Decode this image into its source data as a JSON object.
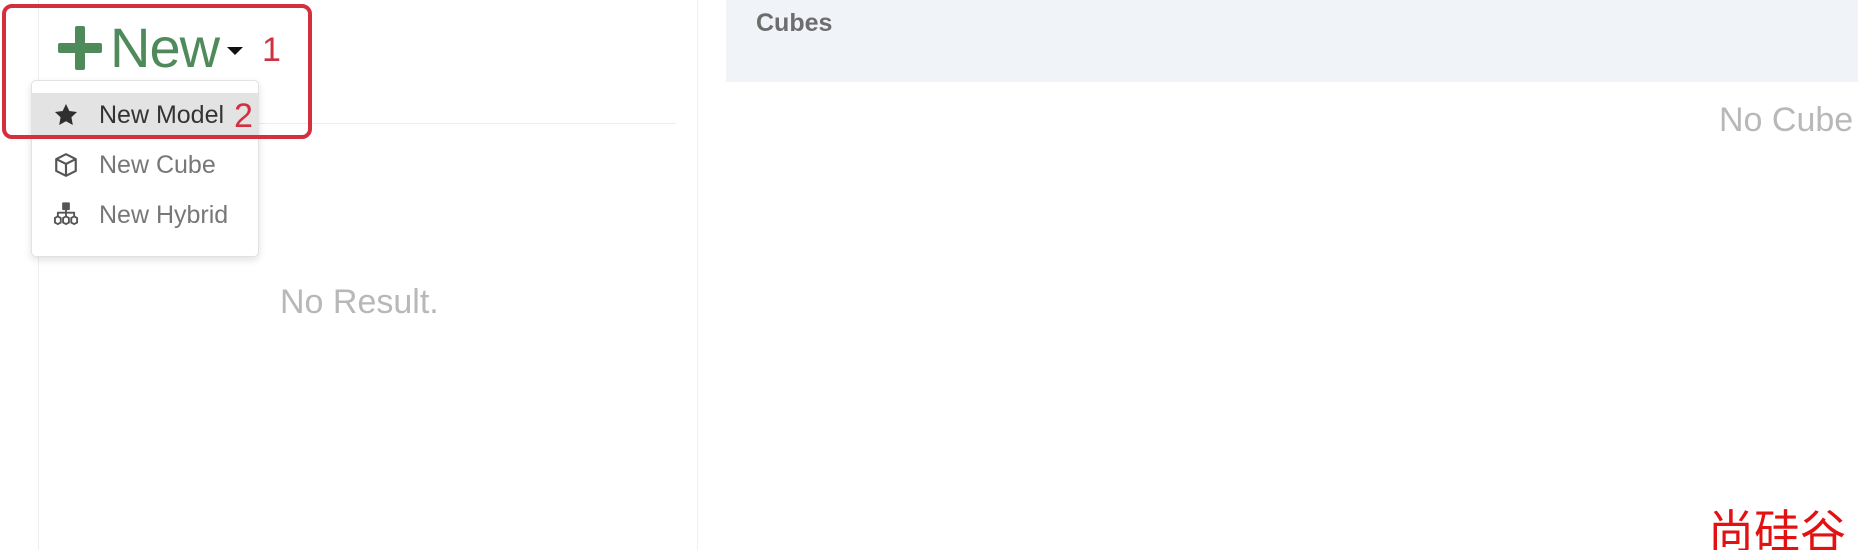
{
  "new_button": {
    "label": "New",
    "annotation": "1"
  },
  "dropdown": {
    "items": [
      {
        "label": "New Model",
        "icon": "star-icon",
        "active": true,
        "annotation": "2"
      },
      {
        "label": "New Cube",
        "icon": "cube-icon",
        "active": false
      },
      {
        "label": "New Hybrid",
        "icon": "hierarchy-icon",
        "active": false
      }
    ]
  },
  "left_panel": {
    "empty_text": "No Result."
  },
  "right_panel": {
    "header_title": "Cubes",
    "empty_text": "No Cube"
  },
  "watermark": {
    "text": "尚硅谷"
  },
  "colors": {
    "accent_green": "#4f8a5b",
    "annotation_red": "#d2303f",
    "header_bg": "#f0f3f7",
    "watermark_red": "#e31212"
  }
}
